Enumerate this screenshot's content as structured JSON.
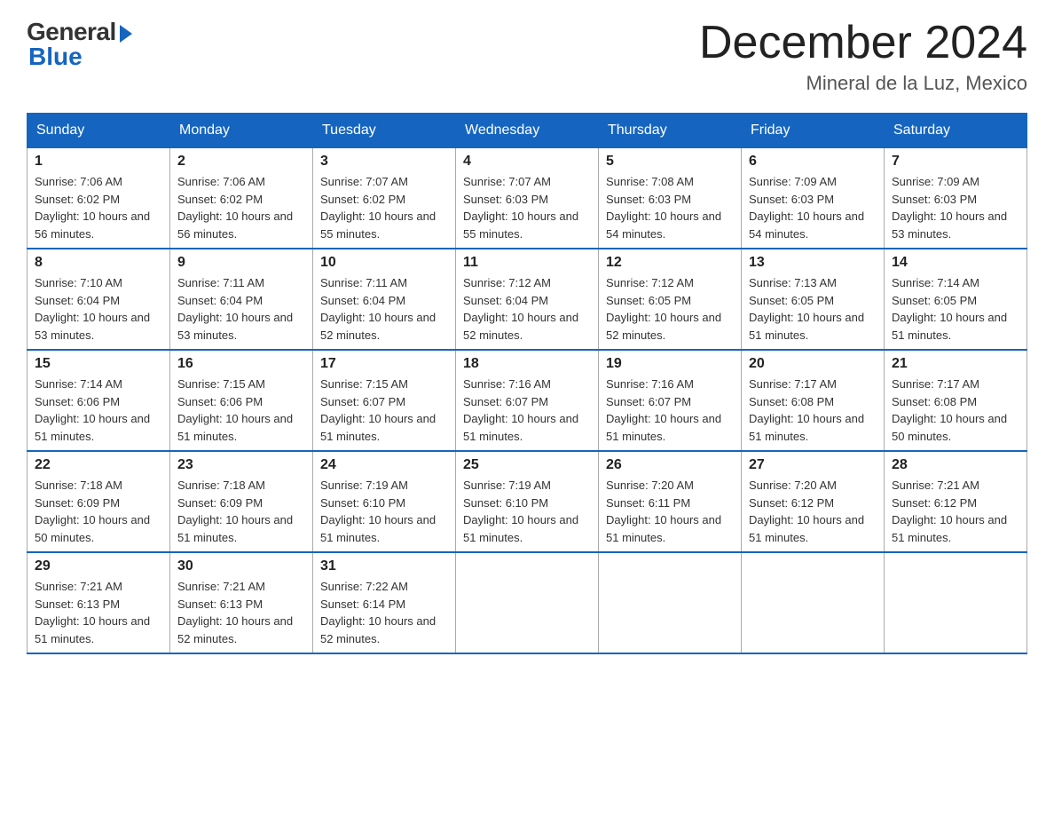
{
  "logo": {
    "general": "General",
    "blue": "Blue"
  },
  "title": "December 2024",
  "location": "Mineral de la Luz, Mexico",
  "days_of_week": [
    "Sunday",
    "Monday",
    "Tuesday",
    "Wednesday",
    "Thursday",
    "Friday",
    "Saturday"
  ],
  "weeks": [
    [
      {
        "day": "1",
        "sunrise": "7:06 AM",
        "sunset": "6:02 PM",
        "daylight": "10 hours and 56 minutes."
      },
      {
        "day": "2",
        "sunrise": "7:06 AM",
        "sunset": "6:02 PM",
        "daylight": "10 hours and 56 minutes."
      },
      {
        "day": "3",
        "sunrise": "7:07 AM",
        "sunset": "6:02 PM",
        "daylight": "10 hours and 55 minutes."
      },
      {
        "day": "4",
        "sunrise": "7:07 AM",
        "sunset": "6:03 PM",
        "daylight": "10 hours and 55 minutes."
      },
      {
        "day": "5",
        "sunrise": "7:08 AM",
        "sunset": "6:03 PM",
        "daylight": "10 hours and 54 minutes."
      },
      {
        "day": "6",
        "sunrise": "7:09 AM",
        "sunset": "6:03 PM",
        "daylight": "10 hours and 54 minutes."
      },
      {
        "day": "7",
        "sunrise": "7:09 AM",
        "sunset": "6:03 PM",
        "daylight": "10 hours and 53 minutes."
      }
    ],
    [
      {
        "day": "8",
        "sunrise": "7:10 AM",
        "sunset": "6:04 PM",
        "daylight": "10 hours and 53 minutes."
      },
      {
        "day": "9",
        "sunrise": "7:11 AM",
        "sunset": "6:04 PM",
        "daylight": "10 hours and 53 minutes."
      },
      {
        "day": "10",
        "sunrise": "7:11 AM",
        "sunset": "6:04 PM",
        "daylight": "10 hours and 52 minutes."
      },
      {
        "day": "11",
        "sunrise": "7:12 AM",
        "sunset": "6:04 PM",
        "daylight": "10 hours and 52 minutes."
      },
      {
        "day": "12",
        "sunrise": "7:12 AM",
        "sunset": "6:05 PM",
        "daylight": "10 hours and 52 minutes."
      },
      {
        "day": "13",
        "sunrise": "7:13 AM",
        "sunset": "6:05 PM",
        "daylight": "10 hours and 51 minutes."
      },
      {
        "day": "14",
        "sunrise": "7:14 AM",
        "sunset": "6:05 PM",
        "daylight": "10 hours and 51 minutes."
      }
    ],
    [
      {
        "day": "15",
        "sunrise": "7:14 AM",
        "sunset": "6:06 PM",
        "daylight": "10 hours and 51 minutes."
      },
      {
        "day": "16",
        "sunrise": "7:15 AM",
        "sunset": "6:06 PM",
        "daylight": "10 hours and 51 minutes."
      },
      {
        "day": "17",
        "sunrise": "7:15 AM",
        "sunset": "6:07 PM",
        "daylight": "10 hours and 51 minutes."
      },
      {
        "day": "18",
        "sunrise": "7:16 AM",
        "sunset": "6:07 PM",
        "daylight": "10 hours and 51 minutes."
      },
      {
        "day": "19",
        "sunrise": "7:16 AM",
        "sunset": "6:07 PM",
        "daylight": "10 hours and 51 minutes."
      },
      {
        "day": "20",
        "sunrise": "7:17 AM",
        "sunset": "6:08 PM",
        "daylight": "10 hours and 51 minutes."
      },
      {
        "day": "21",
        "sunrise": "7:17 AM",
        "sunset": "6:08 PM",
        "daylight": "10 hours and 50 minutes."
      }
    ],
    [
      {
        "day": "22",
        "sunrise": "7:18 AM",
        "sunset": "6:09 PM",
        "daylight": "10 hours and 50 minutes."
      },
      {
        "day": "23",
        "sunrise": "7:18 AM",
        "sunset": "6:09 PM",
        "daylight": "10 hours and 51 minutes."
      },
      {
        "day": "24",
        "sunrise": "7:19 AM",
        "sunset": "6:10 PM",
        "daylight": "10 hours and 51 minutes."
      },
      {
        "day": "25",
        "sunrise": "7:19 AM",
        "sunset": "6:10 PM",
        "daylight": "10 hours and 51 minutes."
      },
      {
        "day": "26",
        "sunrise": "7:20 AM",
        "sunset": "6:11 PM",
        "daylight": "10 hours and 51 minutes."
      },
      {
        "day": "27",
        "sunrise": "7:20 AM",
        "sunset": "6:12 PM",
        "daylight": "10 hours and 51 minutes."
      },
      {
        "day": "28",
        "sunrise": "7:21 AM",
        "sunset": "6:12 PM",
        "daylight": "10 hours and 51 minutes."
      }
    ],
    [
      {
        "day": "29",
        "sunrise": "7:21 AM",
        "sunset": "6:13 PM",
        "daylight": "10 hours and 51 minutes."
      },
      {
        "day": "30",
        "sunrise": "7:21 AM",
        "sunset": "6:13 PM",
        "daylight": "10 hours and 52 minutes."
      },
      {
        "day": "31",
        "sunrise": "7:22 AM",
        "sunset": "6:14 PM",
        "daylight": "10 hours and 52 minutes."
      },
      null,
      null,
      null,
      null
    ]
  ],
  "labels": {
    "sunrise": "Sunrise:",
    "sunset": "Sunset:",
    "daylight": "Daylight:"
  }
}
